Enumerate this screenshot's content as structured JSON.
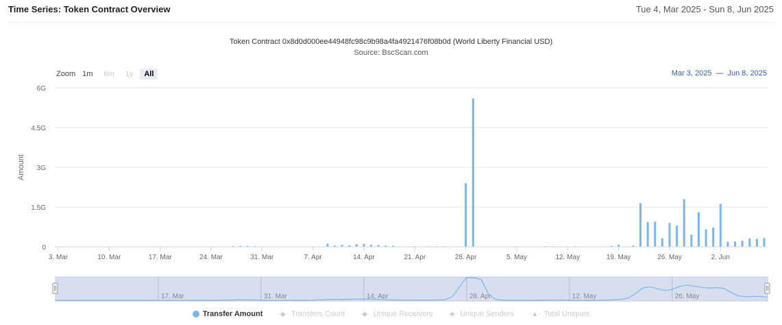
{
  "header": {
    "title": "Time Series: Token Contract Overview",
    "date_range": "Tue 4, Mar 2025 - Sun 8, Jun 2025"
  },
  "zoom": {
    "label": "Zoom",
    "buttons": [
      "1m",
      "6m",
      "1y",
      "All"
    ],
    "active": "All"
  },
  "range_input": {
    "from": "Mar 3, 2025",
    "to": "Jun 8, 2025"
  },
  "legend": [
    {
      "label": "Transfer Amount",
      "symbol": "circle",
      "active": true
    },
    {
      "label": "Transfers Count",
      "symbol": "diamond",
      "active": false
    },
    {
      "label": "Unique Receivers",
      "symbol": "diamond",
      "active": false
    },
    {
      "label": "Unique Senders",
      "symbol": "square",
      "active": false
    },
    {
      "label": "Total Uniques",
      "symbol": "triangle",
      "active": false
    }
  ],
  "colors": {
    "series": "#7cb5ec",
    "navigator_mask": "#d0d8ec",
    "grid": "#e6e6e6"
  },
  "chart_data": {
    "type": "bar",
    "title": "Token Contract 0x8d0d000ee44948fc98c9b98a4fa4921476f08b0d (World Liberty Financial USD)",
    "subtitle": "Source: BscScan.com",
    "ylabel": "Amount",
    "ylim": [
      0,
      6000000000
    ],
    "yticks": [
      0,
      1500000000,
      3000000000,
      4500000000,
      6000000000
    ],
    "ytick_labels": [
      "0",
      "1.5G",
      "3G",
      "4.5G",
      "6G"
    ],
    "xlim": [
      "2025-03-03",
      "2025-06-08"
    ],
    "xticks": [
      "2025-03-03",
      "2025-03-10",
      "2025-03-17",
      "2025-03-24",
      "2025-03-31",
      "2025-04-07",
      "2025-04-14",
      "2025-04-21",
      "2025-04-28",
      "2025-05-05",
      "2025-05-12",
      "2025-05-19",
      "2025-05-26",
      "2025-06-02"
    ],
    "xtick_labels": [
      "3. Mar",
      "10. Mar",
      "17. Mar",
      "24. Mar",
      "31. Mar",
      "7. Apr",
      "14. Apr",
      "21. Apr",
      "28. Apr",
      "5. May",
      "12. May",
      "19. May",
      "26. May",
      "2. Jun"
    ],
    "navigator_labels": [
      "17. Mar",
      "31. Mar",
      "14. Apr",
      "28. Apr",
      "12. May",
      "26. May"
    ],
    "navigator_ticks": [
      "2025-03-17",
      "2025-03-31",
      "2025-04-14",
      "2025-04-28",
      "2025-05-12",
      "2025-05-26"
    ],
    "series": [
      {
        "name": "Transfer Amount",
        "points": [
          [
            "2025-03-27",
            30000000
          ],
          [
            "2025-03-28",
            40000000
          ],
          [
            "2025-03-29",
            40000000
          ],
          [
            "2025-03-30",
            25000000
          ],
          [
            "2025-04-09",
            120000000
          ],
          [
            "2025-04-10",
            50000000
          ],
          [
            "2025-04-11",
            70000000
          ],
          [
            "2025-04-12",
            60000000
          ],
          [
            "2025-04-13",
            100000000
          ],
          [
            "2025-04-14",
            110000000
          ],
          [
            "2025-04-15",
            80000000
          ],
          [
            "2025-04-16",
            70000000
          ],
          [
            "2025-04-17",
            50000000
          ],
          [
            "2025-04-18",
            40000000
          ],
          [
            "2025-04-21",
            20000000
          ],
          [
            "2025-04-23",
            20000000
          ],
          [
            "2025-04-24",
            20000000
          ],
          [
            "2025-04-25",
            20000000
          ],
          [
            "2025-04-28",
            2400000000
          ],
          [
            "2025-04-29",
            5600000000
          ],
          [
            "2025-05-09",
            20000000
          ],
          [
            "2025-05-10",
            20000000
          ],
          [
            "2025-05-13",
            20000000
          ],
          [
            "2025-05-18",
            40000000
          ],
          [
            "2025-05-19",
            80000000
          ],
          [
            "2025-05-21",
            50000000
          ],
          [
            "2025-05-22",
            1650000000
          ],
          [
            "2025-05-23",
            930000000
          ],
          [
            "2025-05-24",
            950000000
          ],
          [
            "2025-05-25",
            320000000
          ],
          [
            "2025-05-26",
            900000000
          ],
          [
            "2025-05-27",
            800000000
          ],
          [
            "2025-05-28",
            1800000000
          ],
          [
            "2025-05-29",
            460000000
          ],
          [
            "2025-05-30",
            1300000000
          ],
          [
            "2025-05-31",
            660000000
          ],
          [
            "2025-06-01",
            730000000
          ],
          [
            "2025-06-02",
            1620000000
          ],
          [
            "2025-06-03",
            190000000
          ],
          [
            "2025-06-04",
            200000000
          ],
          [
            "2025-06-05",
            230000000
          ],
          [
            "2025-06-06",
            320000000
          ],
          [
            "2025-06-07",
            300000000
          ],
          [
            "2025-06-08",
            330000000
          ]
        ]
      }
    ]
  }
}
